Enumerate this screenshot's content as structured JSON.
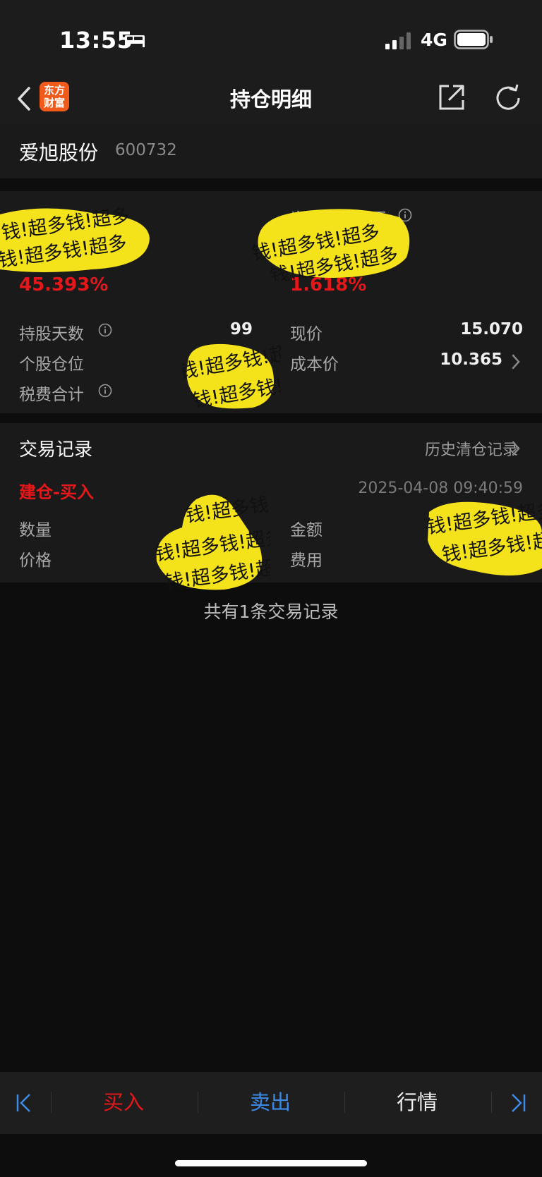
{
  "status": {
    "time": "13:55",
    "network": "4G"
  },
  "nav": {
    "title": "持仓明细",
    "logo_line1": "东方",
    "logo_line2": "财富"
  },
  "stock": {
    "name": "爱旭股份",
    "code": "600732"
  },
  "summary": {
    "left_pct": "45.393%",
    "daily_label": "当日参考盈亏",
    "daily_pct": "1.618%",
    "hold_days_label": "持股天数",
    "hold_days_value": "99",
    "position_label": "个股仓位",
    "tax_label": "税费合计",
    "price_label": "现价",
    "price_value": "15.070",
    "cost_label": "成本价",
    "cost_value": "10.365"
  },
  "trades": {
    "title": "交易记录",
    "history_link": "历史清仓记录",
    "record": {
      "type": "建仓-买入",
      "time": "2025-04-08 09:40:59",
      "qty_label": "数量",
      "price_label": "价格",
      "amount_label": "金额",
      "fee_label": "费用"
    },
    "count_text": "共有1条交易记录"
  },
  "toolbar": {
    "buy": "买入",
    "sell": "卖出",
    "quote": "行情"
  },
  "colors": {
    "red": "#e4171a",
    "blue": "#3d8be8",
    "sticker": "#f4e21a",
    "logo": "#f05a1a"
  },
  "sticker_text": "钱!超多钱!超多"
}
